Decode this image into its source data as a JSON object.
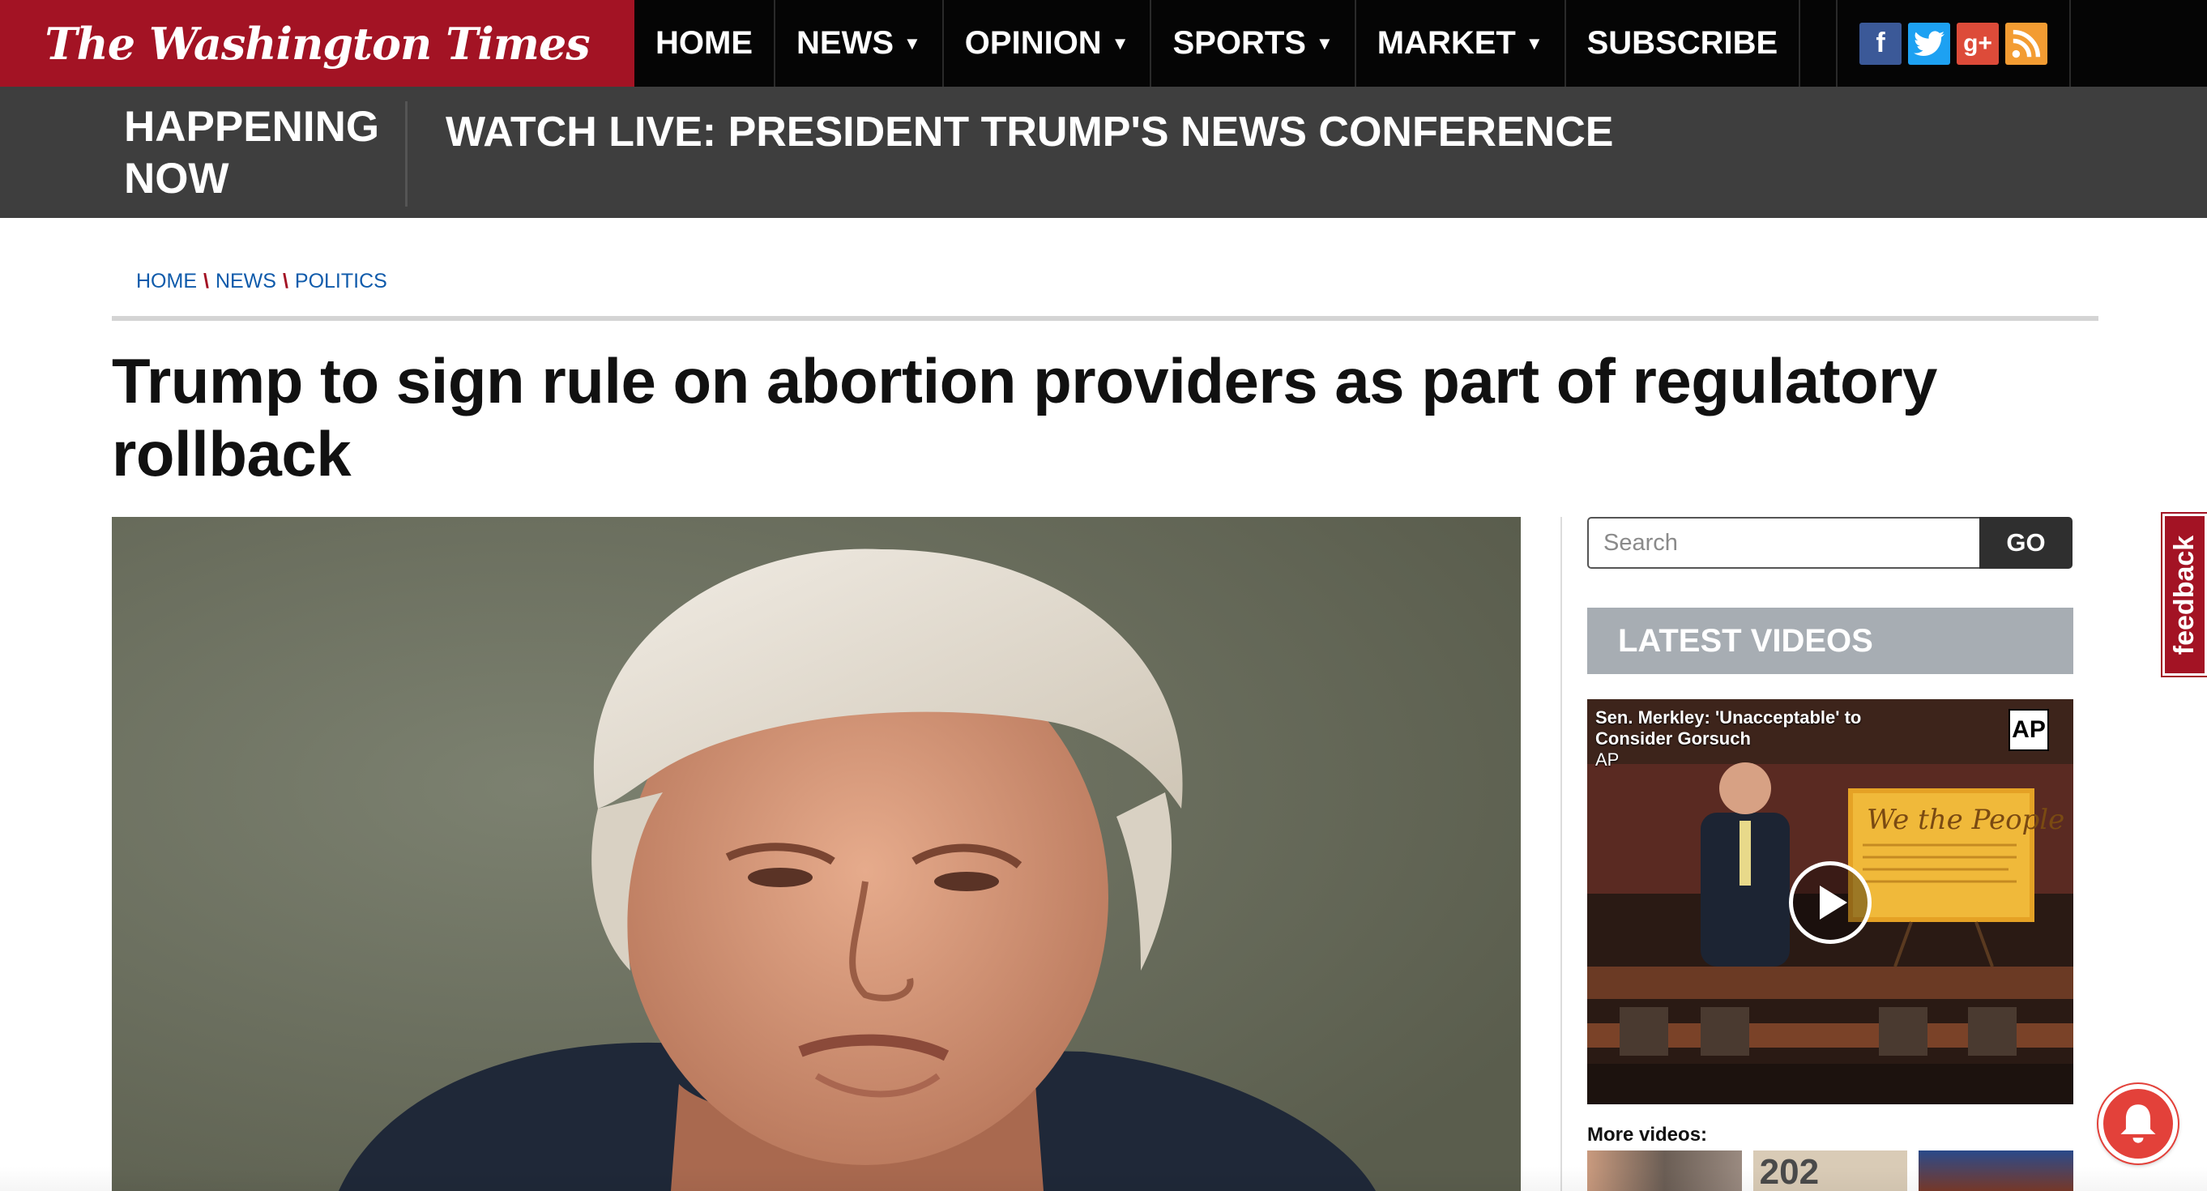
{
  "site": {
    "logo_text": "The Washington Times",
    "brand_color": "#a31324"
  },
  "nav": {
    "items": [
      {
        "label": "HOME",
        "dropdown": false
      },
      {
        "label": "NEWS",
        "dropdown": true
      },
      {
        "label": "OPINION",
        "dropdown": true
      },
      {
        "label": "SPORTS",
        "dropdown": true
      },
      {
        "label": "MARKET",
        "dropdown": true
      },
      {
        "label": "SUBSCRIBE",
        "dropdown": false
      }
    ],
    "social": [
      {
        "icon": "facebook-icon",
        "glyph": "f",
        "color": "#3b5998"
      },
      {
        "icon": "twitter-icon",
        "glyph": "t",
        "color": "#1da1f2"
      },
      {
        "icon": "google-plus-icon",
        "glyph": "g+",
        "color": "#dd4b39"
      },
      {
        "icon": "rss-icon",
        "glyph": "rss",
        "color": "#f39c32"
      }
    ]
  },
  "happening": {
    "label": "HAPPENING NOW",
    "link": "WATCH LIVE: PRESIDENT TRUMP'S NEWS CONFERENCE"
  },
  "breadcrumb": {
    "items": [
      "HOME",
      "NEWS",
      "POLITICS"
    ],
    "separator": "\\"
  },
  "article": {
    "headline": "Trump to sign rule on abortion providers as part of regulatory rollback"
  },
  "sidebar": {
    "search_placeholder": "Search",
    "search_value": "",
    "go_label": "GO",
    "latest_videos_label": "LATEST VIDEOS",
    "video": {
      "title": "Sen. Merkley: 'Unacceptable' to Consider Gorsuch",
      "source": "AP",
      "badge": "AP",
      "poster_text": "We the People"
    },
    "more_videos_label": "More videos:",
    "thumb_text": "202"
  },
  "feedback_label": "feedback"
}
